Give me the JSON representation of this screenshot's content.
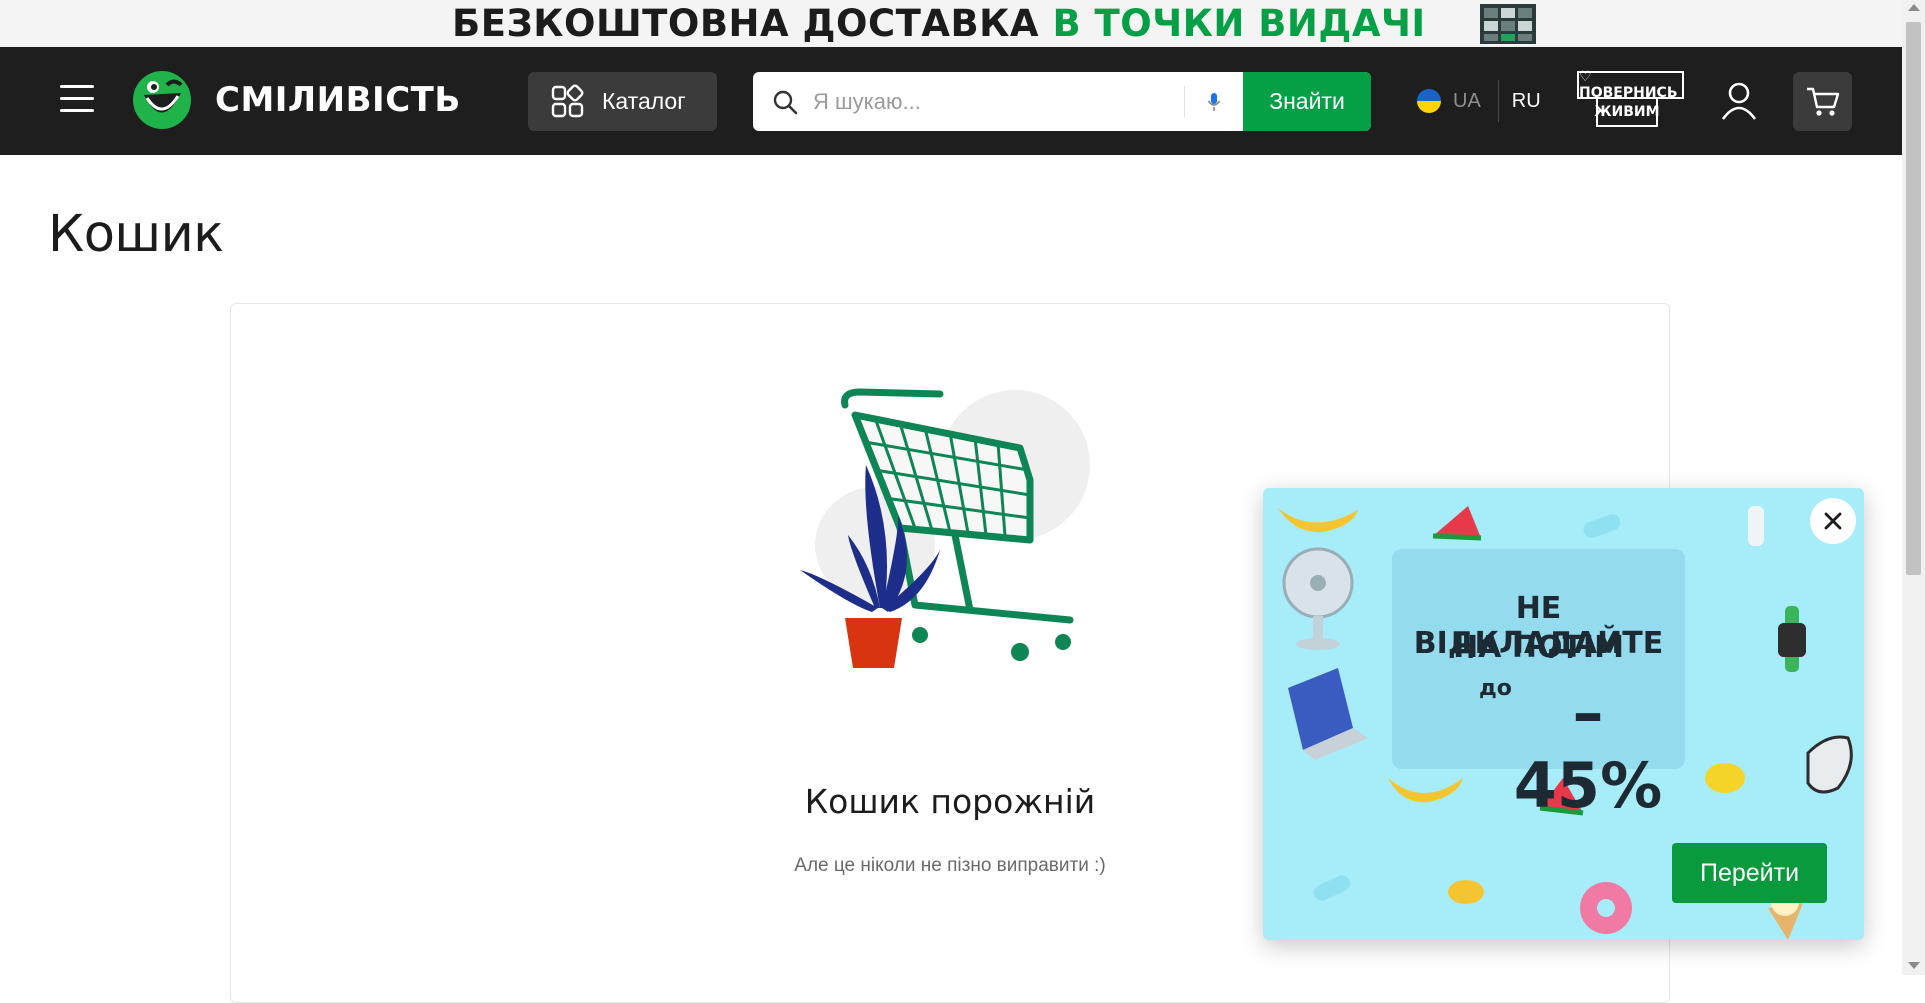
{
  "promo_banner": {
    "text_main": "БЕЗКОШТОВНА ДОСТАВКА",
    "text_accent": "В ТОЧКИ ВИДАЧІ",
    "accent_color": "#05a045"
  },
  "header": {
    "menu_icon": "hamburger-icon",
    "logo_text": "СМІЛИВІСТЬ",
    "catalog_label": "Каталог",
    "search": {
      "placeholder": "Я шукаю...",
      "value": "",
      "button_label": "Знайти"
    },
    "languages": {
      "active": "UA",
      "other": "RU"
    },
    "campaign_badge": {
      "top": "♡ ПОВЕРНИСЬ",
      "bottom": "ЖИВИМ"
    },
    "brand_color": "#05a045",
    "bar_color": "#1e1e1e"
  },
  "main": {
    "page_title": "Кошик",
    "empty_title": "Кошик порожній",
    "empty_subtitle": "Але це ніколи не пізно виправити :)"
  },
  "popup": {
    "headline_line1": "НЕ ВІДКЛАДАЙТЕ",
    "headline_line2": "НА ПОТІМ",
    "upto": "до",
    "discount": "–45%",
    "cta_label": "Перейти",
    "background_color": "#a6ecf9"
  }
}
